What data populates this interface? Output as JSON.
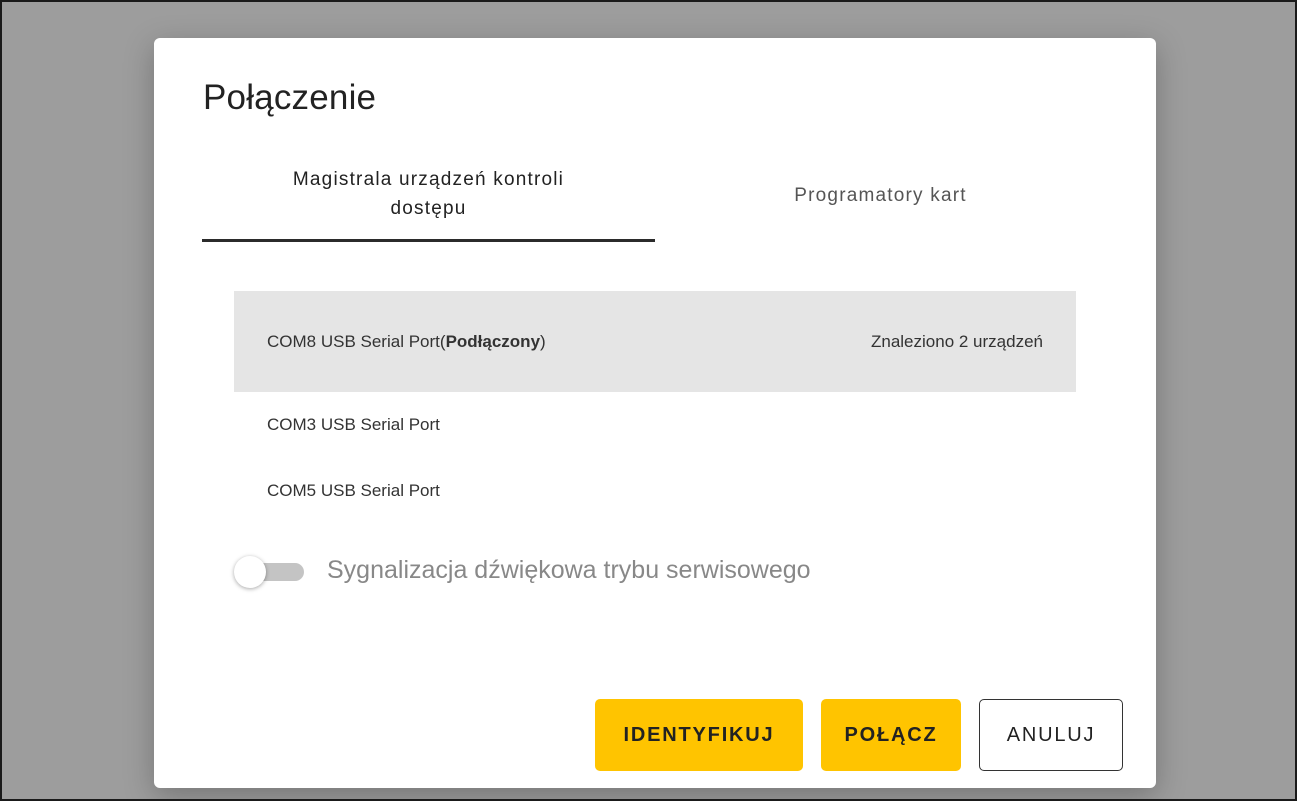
{
  "dialog": {
    "title": "Połączenie"
  },
  "tabs": [
    {
      "label": "Magistrala urządzeń kontroli dostępu",
      "active": true
    },
    {
      "label": "Programatory kart",
      "active": false
    }
  ],
  "ports": [
    {
      "name": "COM8 USB Serial Port",
      "status_open": " (",
      "status": "Podłączony",
      "status_close": ")",
      "found": "Znaleziono 2 urządzeń",
      "selected": true
    },
    {
      "name": "COM3 USB Serial Port",
      "selected": false
    },
    {
      "name": "COM5 USB Serial Port",
      "selected": false
    }
  ],
  "service_sound": {
    "label": "Sygnalizacja dźwiękowa trybu serwisowego",
    "enabled": false
  },
  "actions": {
    "identify_label": "IDENTYFIKUJ",
    "connect_label": "POŁĄCZ",
    "cancel_label": "ANULUJ"
  },
  "colors": {
    "accent": "#ffc400",
    "selected_row": "#e5e5e5",
    "overlay": "#9d9d9d"
  }
}
